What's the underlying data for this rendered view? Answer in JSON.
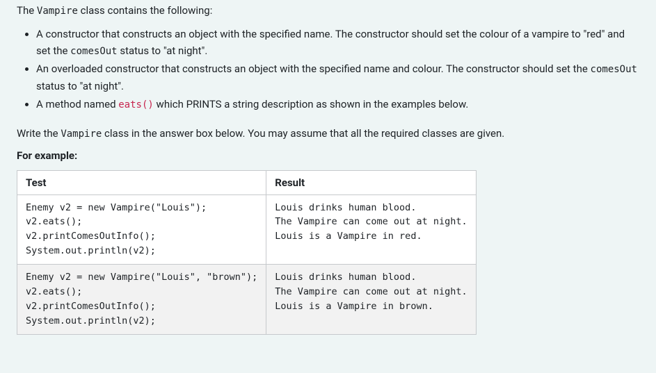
{
  "intro": {
    "prefix": "The ",
    "className": "Vampire",
    "suffix": " class contains the following:"
  },
  "bullets": [
    {
      "pre": "A constructor that constructs an object with the specified name. The constructor should set the colour of a vampire to \"red\" and set the ",
      "code": "comesOut",
      "post": " status to \"at night\"."
    },
    {
      "pre": "An overloaded constructor that constructs an object with the specified name and colour. The constructor should set the ",
      "code": "comesOut",
      "post": " status to \"at night\"."
    },
    {
      "pre": "A method named ",
      "code": "eats()",
      "post": " which PRINTS a string description as shown in the examples below."
    }
  ],
  "writeLine": {
    "pre": "Write the ",
    "className": "Vampire",
    "post": " class in the answer box below. You may assume that all the required classes are given."
  },
  "forExample": "For example:",
  "table": {
    "headers": [
      "Test",
      "Result"
    ],
    "rows": [
      {
        "test": "Enemy v2 = new Vampire(\"Louis\");\nv2.eats();\nv2.printComesOutInfo();\nSystem.out.println(v2);",
        "result": "Louis drinks human blood.\nThe Vampire can come out at night.\nLouis is a Vampire in red."
      },
      {
        "test": "Enemy v2 = new Vampire(\"Louis\", \"brown\");\nv2.eats();\nv2.printComesOutInfo();\nSystem.out.println(v2);",
        "result": "Louis drinks human blood.\nThe Vampire can come out at night.\nLouis is a Vampire in brown."
      }
    ]
  }
}
